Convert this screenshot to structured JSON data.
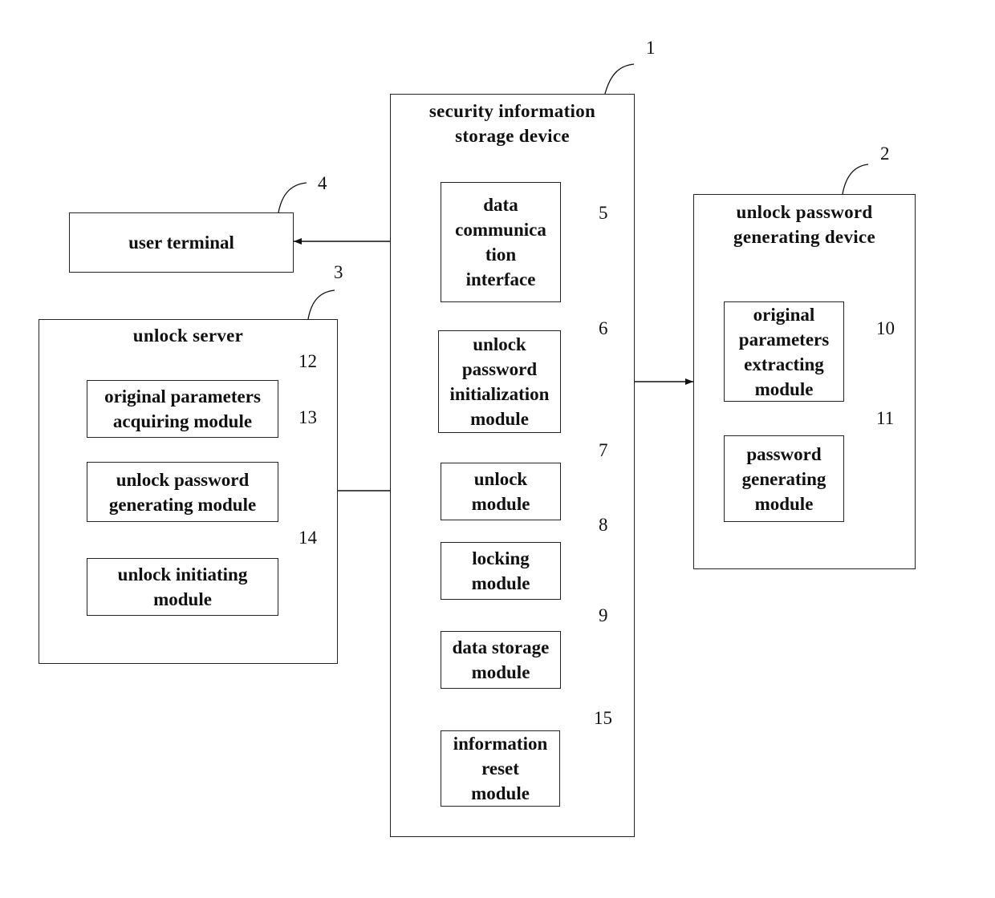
{
  "devices": {
    "security_storage": {
      "ref": "1",
      "title": "security information\nstorage device"
    },
    "password_device": {
      "ref": "2",
      "title": "unlock password\ngenerating device"
    },
    "unlock_server": {
      "ref": "3",
      "title": "unlock server"
    },
    "user_terminal": {
      "ref": "4",
      "title": "user terminal"
    }
  },
  "modules": {
    "data_comm": {
      "ref": "5",
      "label": "data\ncommunica\ntion\ninterface"
    },
    "pwd_init": {
      "ref": "6",
      "label": "unlock\npassword\ninitialization\nmodule"
    },
    "unlock": {
      "ref": "7",
      "label": "unlock\nmodule"
    },
    "locking": {
      "ref": "8",
      "label": "locking\nmodule"
    },
    "data_storage": {
      "ref": "9",
      "label": "data storage\nmodule"
    },
    "orig_extract": {
      "ref": "10",
      "label": "original\nparameters\nextracting\nmodule"
    },
    "pwd_gen": {
      "ref": "11",
      "label": "password\ngenerating\nmodule"
    },
    "orig_acquire": {
      "ref": "12",
      "label": "original parameters\nacquiring module"
    },
    "unlock_pwd_gen": {
      "ref": "13",
      "label": "unlock password\ngenerating module"
    },
    "unlock_init": {
      "ref": "14",
      "label": "unlock initiating\nmodule"
    },
    "info_reset": {
      "ref": "15",
      "label": "information\nreset\nmodule"
    }
  },
  "connections": [
    {
      "from": "user terminal",
      "to": "data communication interface",
      "type": "bidirectional"
    },
    {
      "from": "unlock password initialization module",
      "to": "unlock password generating device",
      "type": "bidirectional"
    },
    {
      "from": "unlock password generating module",
      "to": "unlock module",
      "type": "bidirectional"
    }
  ]
}
